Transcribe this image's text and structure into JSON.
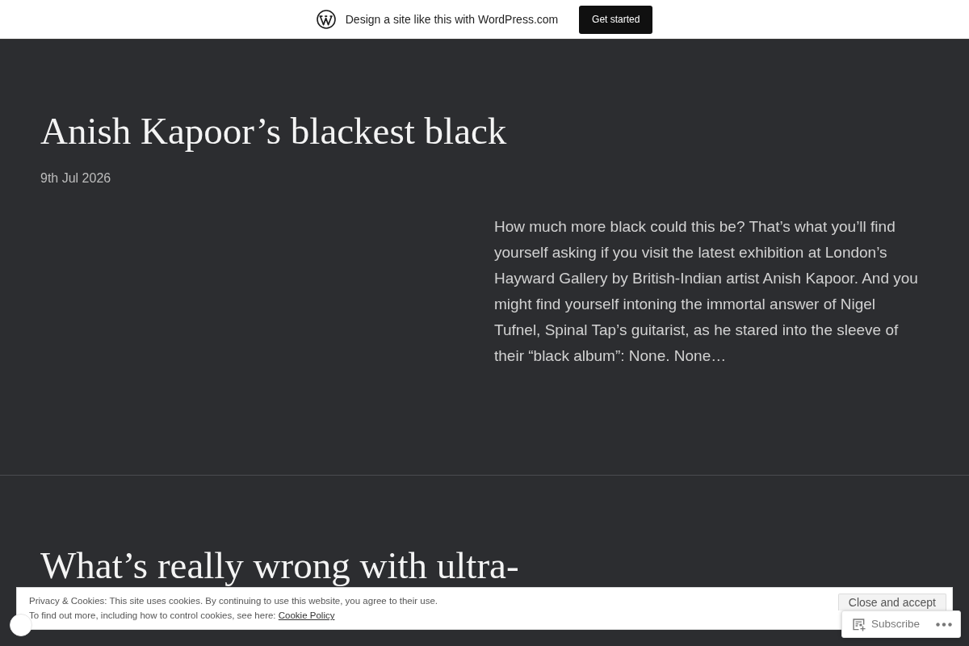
{
  "top_bar": {
    "text": "Design a site like this with WordPress.com",
    "button": "Get started"
  },
  "posts": [
    {
      "title": "Anish Kapoor’s blackest black",
      "date": "9th Jul 2026",
      "excerpt": "How much more black could this be? That’s what you’ll find yourself asking if you visit the latest exhibition at London’s Hayward Gallery by British-Indian artist Anish Kapoor. And you might find yourself intoning the immortal answer of Nigel Tufnel, Spinal Tap’s guitarist, as he stared into the sleeve of their “black album”: None. None…"
    },
    {
      "title": "What’s really wrong with ultra-"
    }
  ],
  "cookie_banner": {
    "text": "Privacy & Cookies: This site uses cookies. By continuing to use this website, you agree to their use.",
    "more_info": "To find out more, including how to control cookies, see here:",
    "link": "Cookie Policy",
    "button": "Close and accept"
  },
  "subscribe_bar": {
    "button": "Subscribe"
  }
}
